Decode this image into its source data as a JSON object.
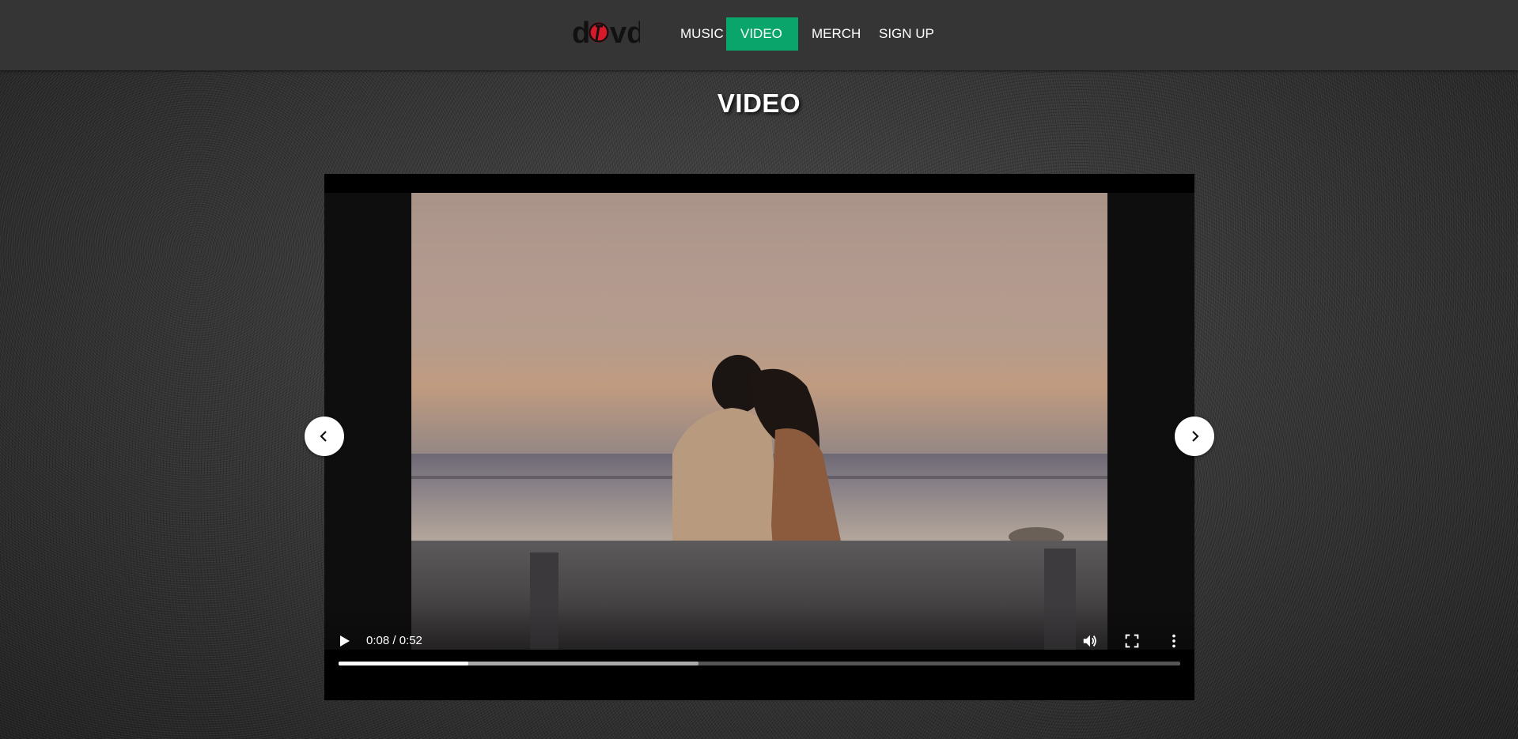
{
  "header": {
    "logo_text": "d vd",
    "nav": [
      {
        "label": "MUSIC",
        "active": false
      },
      {
        "label": "VIDEO",
        "active": true
      },
      {
        "label": "MERCH",
        "active": false
      },
      {
        "label": "SIGN UP",
        "active": false
      }
    ],
    "accent_color": "#0aa56a"
  },
  "page": {
    "title": "VIDEO"
  },
  "player": {
    "time_display": "0:08 / 0:52",
    "played_fraction": 0.154,
    "buffered_fraction": 0.428,
    "icons": [
      "play-icon",
      "volume-icon",
      "fullscreen-icon",
      "more-options-icon"
    ]
  },
  "carousel": {
    "icons": [
      "chevron-left-icon",
      "chevron-right-icon"
    ]
  }
}
